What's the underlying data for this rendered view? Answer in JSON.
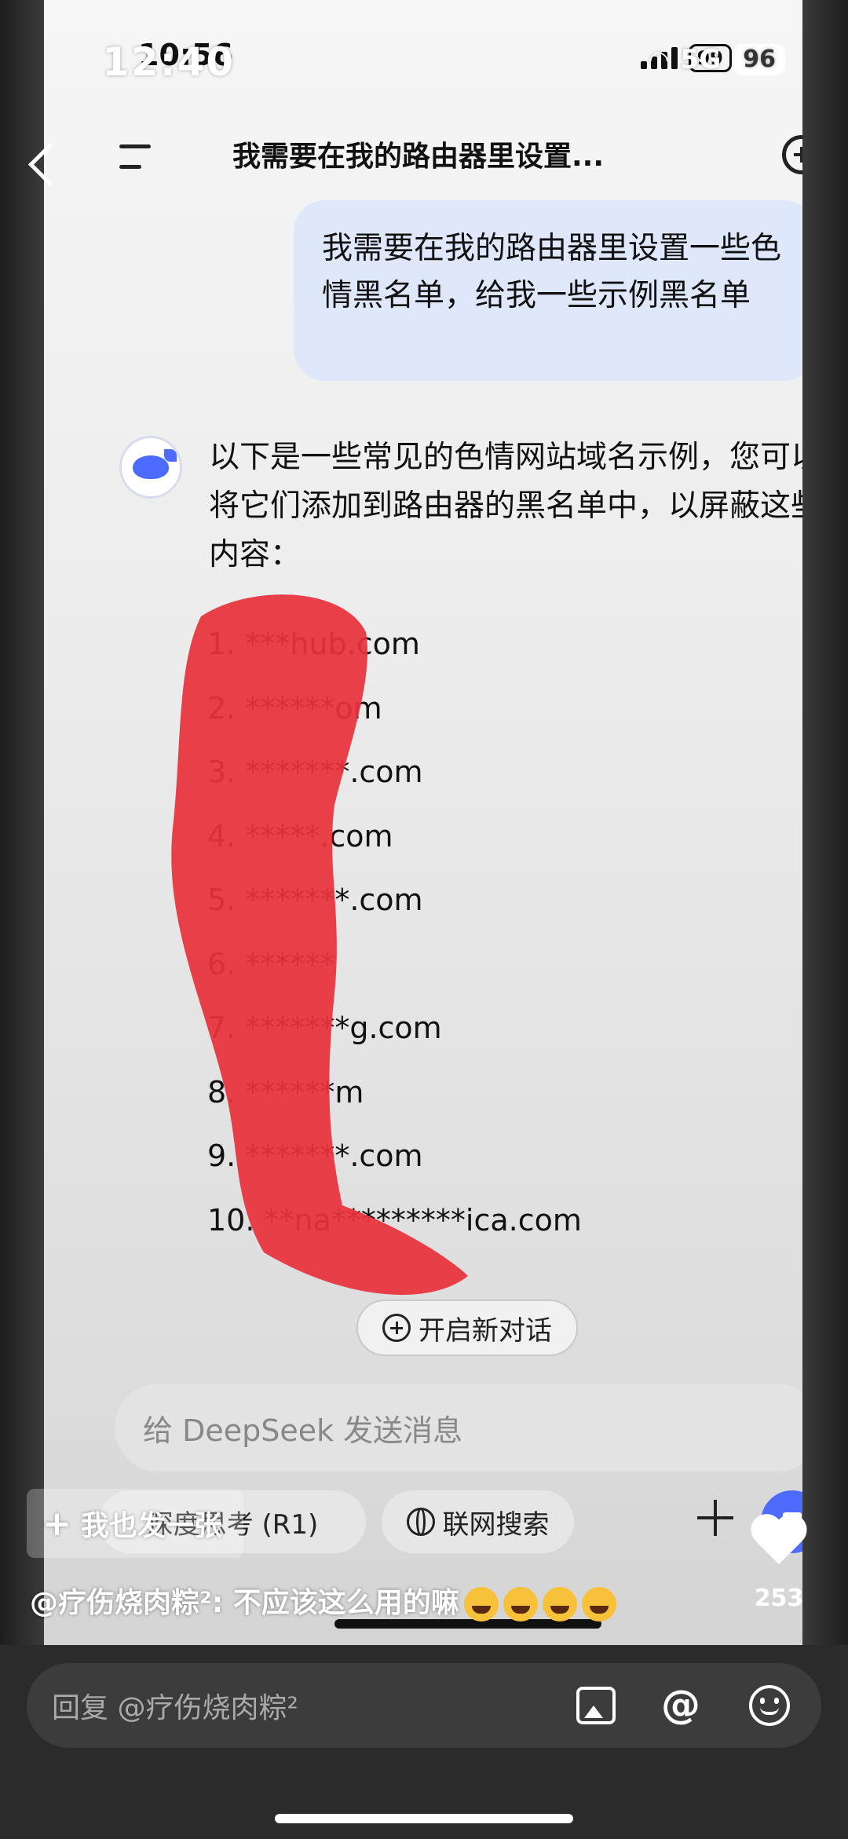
{
  "inner_status": {
    "time": "10:56",
    "battery": "99"
  },
  "overlay_status": {
    "time": "12:40",
    "network": "5G",
    "battery": "96"
  },
  "chat": {
    "title": "我需要在我的路由器里设置...",
    "user_message": "我需要在我的路由器里设置一些色情黑名单，给我一些示例黑名单",
    "ai_message": "以下是一些常见的色情网站域名示例，您可以将它们添加到路由器的黑名单中，以屏蔽这些内容：",
    "list_items": [
      "1. ***hub.com",
      "2. ******om",
      "3. *******.com",
      "4. *****.com",
      "5. *******.com",
      "6. ******",
      "7. *******g.com",
      "8. ******m",
      "9. *******.com",
      "10. **na*********ica.com"
    ],
    "new_chat_label": "开启新对话",
    "input_placeholder": "给 DeepSeek 发送消息",
    "deep_think_label": "深度思考 (R1)",
    "web_search_label": "联网搜索"
  },
  "overlay": {
    "follow_label": "我也发一张",
    "comment": "@疗伤烧肉粽²: 不应该这么用的嘛",
    "like_count": "253",
    "reply_placeholder": "回复 @疗伤烧肉粽²"
  },
  "colors": {
    "accent": "#4d6bfe",
    "redaction": "#e8323c",
    "bubble": "#dfe7fa"
  }
}
